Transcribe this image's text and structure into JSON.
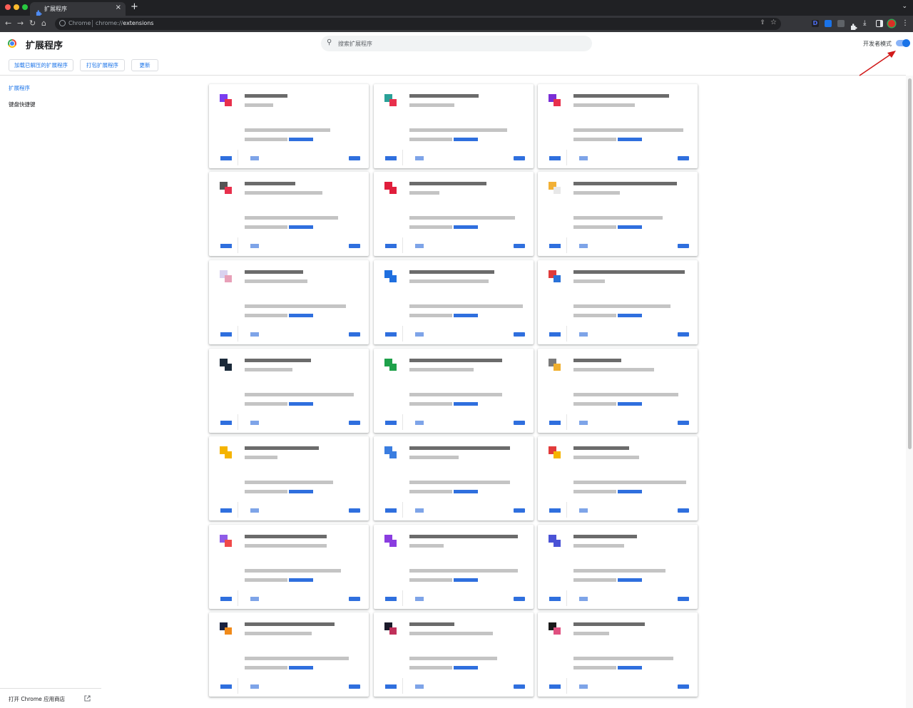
{
  "browser": {
    "tab_title": "扩展程序",
    "tab_close": "×",
    "new_tab": "+",
    "tab_menu": "⌄",
    "chip": "Chrome",
    "url_scheme": "chrome://",
    "url_host": "extensions"
  },
  "header": {
    "title": "扩展程序",
    "search_placeholder": "搜索扩展程序",
    "dev_mode_label": "开发者模式",
    "dev_mode_on": true
  },
  "toolbar": {
    "load_unpacked": "加载已解压的扩展程序",
    "pack": "打包扩展程序",
    "update": "更新"
  },
  "sidebar": {
    "items": [
      {
        "label": "扩展程序",
        "active": true
      },
      {
        "label": "键盘快捷键",
        "active": false
      }
    ],
    "store_link": "打开 Chrome 应用商店"
  },
  "colors": {
    "accent": "#1a73e8",
    "annotation_arrow": "#d11a1a"
  },
  "cards": [
    {
      "icon": [
        "#7a3df0",
        "#e8304c"
      ]
    },
    {
      "icon": [
        "#2aa198",
        "#e8304c"
      ]
    },
    {
      "icon": [
        "#7a2ed6",
        "#e8304c"
      ]
    },
    {
      "icon": [
        "#555555",
        "#e8304c"
      ]
    },
    {
      "icon": [
        "#e01e3c",
        "#e01e3c"
      ]
    },
    {
      "icon": [
        "#f2b035",
        "#e8e8e8"
      ]
    },
    {
      "icon": [
        "#d9d2f0",
        "#e8a0b8"
      ]
    },
    {
      "icon": [
        "#1f6fdf",
        "#1f6fdf"
      ]
    },
    {
      "icon": [
        "#e03b3b",
        "#2a72d8"
      ]
    },
    {
      "icon": [
        "#1b2a3a",
        "#1b2a3a"
      ]
    },
    {
      "icon": [
        "#1ea14a",
        "#1ea14a"
      ]
    },
    {
      "icon": [
        "#7a7a7a",
        "#f0b030"
      ]
    },
    {
      "icon": [
        "#f5b400",
        "#f5b400"
      ]
    },
    {
      "icon": [
        "#3a7de0",
        "#3a7de0"
      ]
    },
    {
      "icon": [
        "#e23a3a",
        "#f5b400"
      ]
    },
    {
      "icon": [
        "#8f5ce8",
        "#f04a4a"
      ]
    },
    {
      "icon": [
        "#8a3de0",
        "#8a3de0"
      ]
    },
    {
      "icon": [
        "#4a52d6",
        "#4a52d6"
      ]
    },
    {
      "icon": [
        "#1a2240",
        "#f08a1a"
      ]
    },
    {
      "icon": [
        "#1a1a2a",
        "#c0305a"
      ]
    },
    {
      "icon": [
        "#1a1a1a",
        "#e05080"
      ]
    }
  ]
}
